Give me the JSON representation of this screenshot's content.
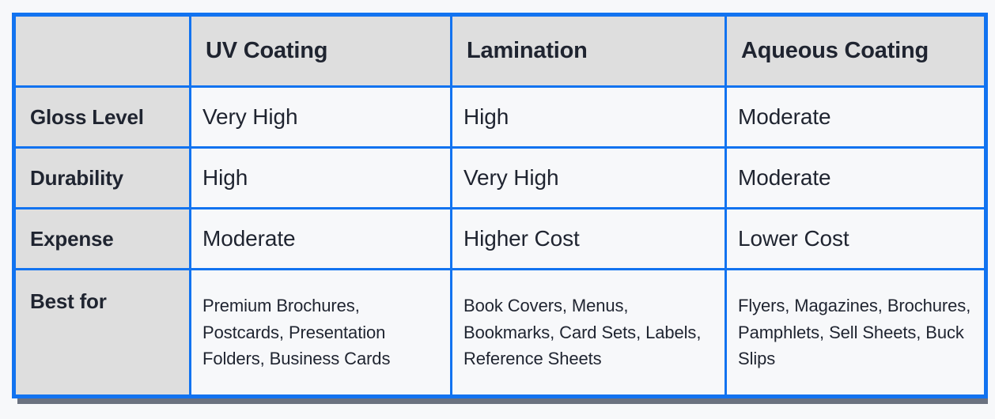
{
  "table": {
    "headers": [
      "",
      "UV Coating",
      "Lamination",
      "Aqueous Coating"
    ],
    "rows": [
      {
        "label": "Gloss Level",
        "values": [
          "Very High",
          "High",
          "Moderate"
        ]
      },
      {
        "label": "Durability",
        "values": [
          "High",
          "Very High",
          "Moderate"
        ]
      },
      {
        "label": "Expense",
        "values": [
          "Moderate",
          "Higher Cost",
          "Lower Cost"
        ]
      },
      {
        "label": "Best for",
        "values": [
          "Premium Brochures, Postcards, Presentation Folders, Business Cards",
          "Book Covers, Menus, Bookmarks, Card Sets, Labels, Reference Sheets",
          "Flyers, Magazines, Brochures, Pamphlets, Sell Sheets, Buck Slips"
        ]
      }
    ]
  },
  "colors": {
    "border_blue": "#1273f0",
    "header_rule": "#22252c",
    "header_fill": "#dedede",
    "cell_fill": "#f7f8fa",
    "text": "#1f2430",
    "shadow": "#6b7280",
    "page_background": "#f7f8fa"
  }
}
